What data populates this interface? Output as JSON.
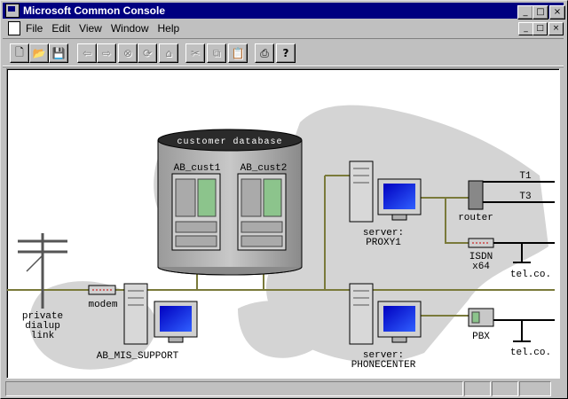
{
  "window": {
    "title": "Microsoft Common Console"
  },
  "menu": {
    "items": [
      "File",
      "Edit",
      "View",
      "Window",
      "Help"
    ]
  },
  "title_buttons": {
    "minimize": "_",
    "maximize": "□",
    "close": "×"
  },
  "toolbar": {
    "buttons": [
      {
        "name": "new-button",
        "icon": "new-doc-icon",
        "glyph": "🗋",
        "enabled": true
      },
      {
        "name": "open-button",
        "icon": "folder-icon",
        "glyph": "📂",
        "enabled": true
      },
      {
        "name": "save-button",
        "icon": "floppy-icon",
        "glyph": "💾",
        "enabled": true
      },
      {
        "name": "back-button",
        "icon": "back-arrow-icon",
        "glyph": "⇦",
        "enabled": false
      },
      {
        "name": "forward-button",
        "icon": "forward-arrow-icon",
        "glyph": "⇨",
        "enabled": false
      },
      {
        "name": "stop-button",
        "icon": "stop-icon",
        "glyph": "⊗",
        "enabled": false
      },
      {
        "name": "refresh-button",
        "icon": "refresh-icon",
        "glyph": "⟳",
        "enabled": false
      },
      {
        "name": "home-button",
        "icon": "home-icon",
        "glyph": "⌂",
        "enabled": false
      },
      {
        "name": "cut-button",
        "icon": "scissors-icon",
        "glyph": "✂",
        "enabled": false
      },
      {
        "name": "copy-button",
        "icon": "copy-icon",
        "glyph": "⧉",
        "enabled": false
      },
      {
        "name": "paste-button",
        "icon": "clipboard-icon",
        "glyph": "📋",
        "enabled": false
      },
      {
        "name": "print-button",
        "icon": "printer-icon",
        "glyph": "⎙",
        "enabled": true
      },
      {
        "name": "help-button",
        "icon": "help-question-icon",
        "glyph": "?",
        "enabled": true
      }
    ]
  },
  "diagram": {
    "database_label": "customer database",
    "db_server1": "AB_cust1",
    "db_server2": "AB_cust2",
    "proxy_label1": "server:",
    "proxy_label2": "PROXY1",
    "router": "router",
    "t1": "T1",
    "t3": "T3",
    "isdn1": "ISDN",
    "isdn2": "x64",
    "telco1": "tel.co.",
    "telco2": "tel.co.",
    "pbx": "PBX",
    "phone_label1": "server:",
    "phone_label2": "PHONECENTER",
    "modem": "modem",
    "mis_support": "AB_MIS_SUPPORT",
    "private1": "private",
    "private2": "dialup",
    "private3": "link"
  }
}
